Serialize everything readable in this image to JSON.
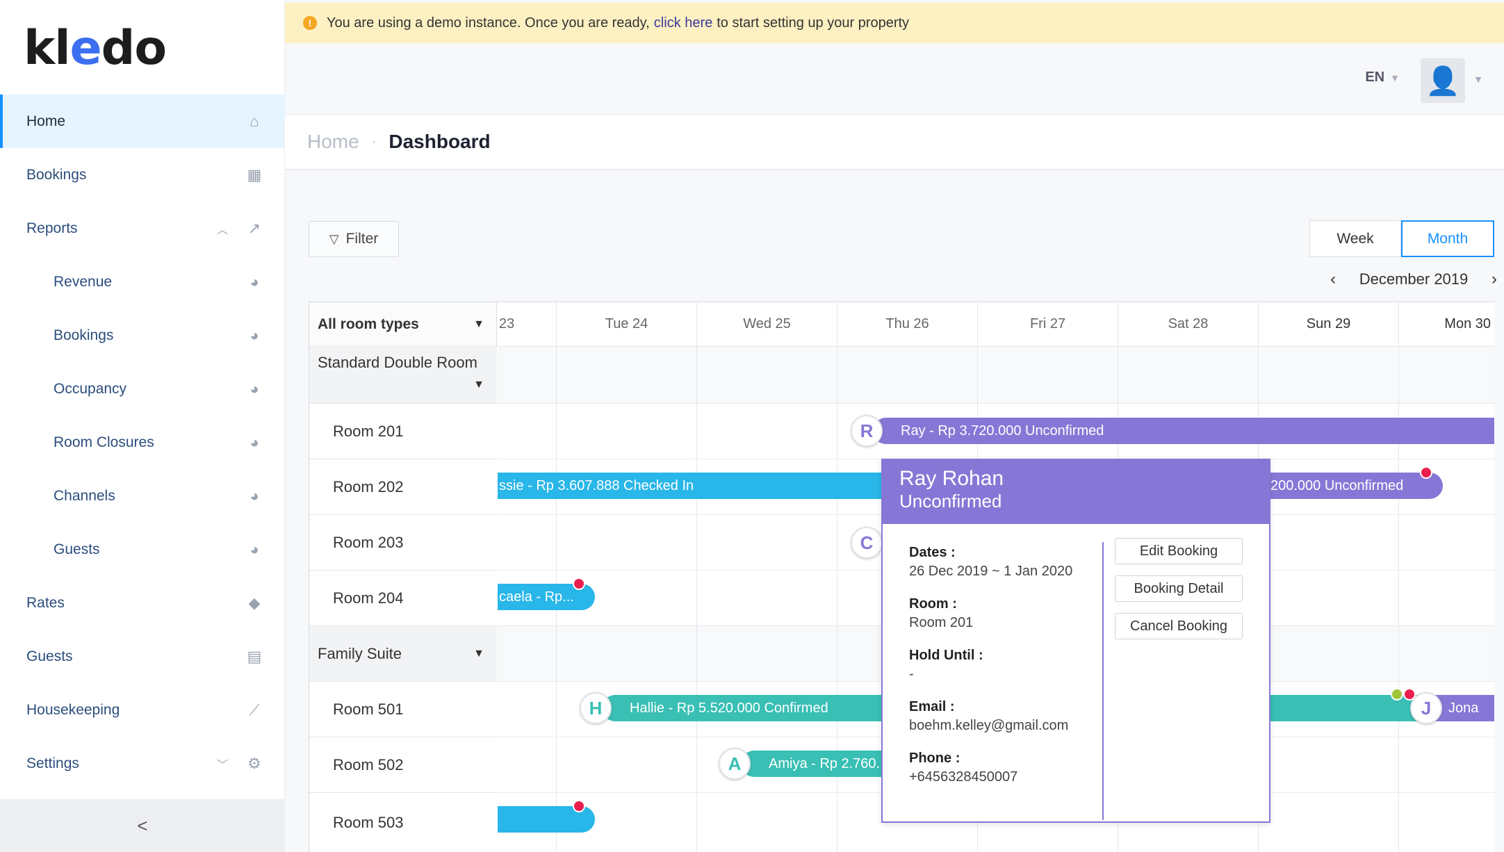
{
  "logo": {
    "text_pre": "kl",
    "text_e": "e",
    "text_post": "do"
  },
  "sidebar": {
    "items": [
      {
        "label": "Home",
        "icon": "home-icon",
        "active": true
      },
      {
        "label": "Bookings",
        "icon": "calendar-icon"
      },
      {
        "label": "Reports",
        "icon": "line-chart-icon"
      },
      {
        "label": "Revenue",
        "icon": "pie-chart-icon"
      },
      {
        "label": "Bookings",
        "icon": "pie-chart-icon"
      },
      {
        "label": "Occupancy",
        "icon": "pie-chart-icon"
      },
      {
        "label": "Room Closures",
        "icon": "pie-chart-icon"
      },
      {
        "label": "Channels",
        "icon": "pie-chart-icon"
      },
      {
        "label": "Guests",
        "icon": "pie-chart-icon"
      },
      {
        "label": "Rates",
        "icon": "tags-icon"
      },
      {
        "label": "Guests",
        "icon": "id-card-icon"
      },
      {
        "label": "Housekeeping",
        "icon": "broom-icon"
      },
      {
        "label": "Settings",
        "icon": "gears-icon"
      }
    ],
    "collapse_label": "<"
  },
  "banner": {
    "text_before": "You are using a demo instance. Once you are ready,",
    "link": "click here",
    "text_after": "to start setting up your property"
  },
  "topbar": {
    "language": "EN"
  },
  "breadcrumb": {
    "home": "Home",
    "current": "Dashboard"
  },
  "toolbar": {
    "filter_label": "Filter",
    "week_label": "Week",
    "month_label": "Month",
    "month": "December 2019"
  },
  "calendar": {
    "room_types_label": "All room types",
    "days": [
      "23",
      "Tue 24",
      "Wed 25",
      "Thu 26",
      "Fri 27",
      "Sat 28",
      "Sun 29",
      "Mon 30"
    ],
    "room_type_1": "Standard Double Room",
    "room_type_2": "Family Suite",
    "rooms": [
      "Room 201",
      "Room 202",
      "Room 203",
      "Room 204",
      "Room 501",
      "Room 502",
      "Room 503"
    ],
    "bookings": {
      "b201": "Ray - Rp 3.720.000 Unconfirmed",
      "b202a": "ssie - Rp 3.607.888 Checked In",
      "b202b": "200.000 Unconfirmed",
      "b204": "caela - Rp...",
      "b501a": "Hallie - Rp 5.520.000 Confirmed",
      "b501b": "Jona",
      "b502": "Amiya - Rp 2.760."
    },
    "initials": {
      "r": "R",
      "h": "H",
      "a": "A",
      "j": "J",
      "c": "C"
    }
  },
  "popover": {
    "name": "Ray Rohan",
    "status": "Unconfirmed",
    "dates_label": "Dates",
    "dates": "26 Dec 2019 ~ 1 Jan 2020",
    "room_label": "Room",
    "room": "Room 201",
    "hold_label": "Hold Until",
    "hold": "-",
    "email_label": "Email",
    "email": "boehm.kelley@gmail.com",
    "phone_label": "Phone",
    "phone": "+6456328450007",
    "colon": ":",
    "edit": "Edit Booking",
    "detail": "Booking Detail",
    "cancel": "Cancel Booking"
  },
  "colors": {
    "accent": "#1890ff",
    "unconfirmed": "#8677d6",
    "checked_in": "#29b6e8",
    "confirmed": "#39bfb4",
    "alert": "#ea1f50"
  }
}
